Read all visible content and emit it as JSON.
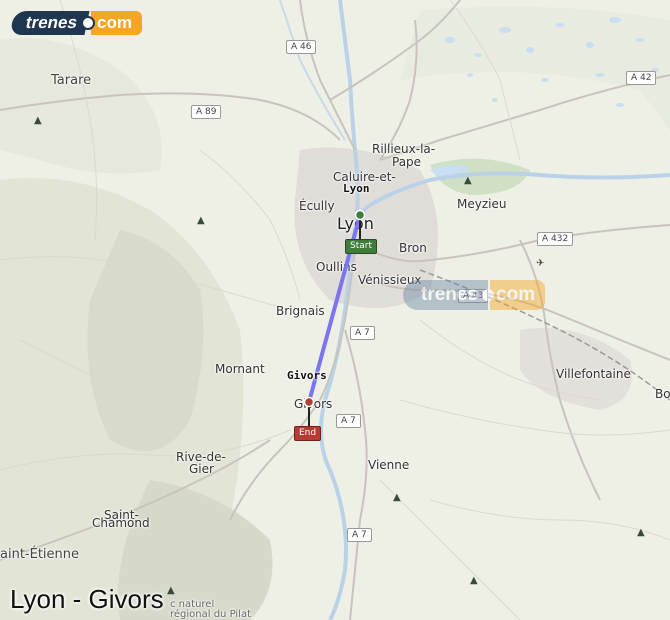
{
  "brand": {
    "part1": "trenes",
    "part2": "com"
  },
  "watermark": {
    "part1": "trenes",
    "part2": "com"
  },
  "route": {
    "title": "Lyon - Givors",
    "origin": "Lyon",
    "destination": "Givors"
  },
  "markers": {
    "start_label": "Start",
    "end_label": "End"
  },
  "places": {
    "lyon": "Lyon",
    "tarare": "Tarare",
    "rillieux": "Rillieux-la-",
    "rillieux2": "Pape",
    "caluire": "Caluire-et-",
    "ecully": "Écully",
    "meyzieu": "Meyzieu",
    "bron": "Bron",
    "oullins": "Oullins",
    "venissieux": "Vénissieux",
    "brignais": "Brignais",
    "mornant": "Mornant",
    "givors": "Givors",
    "villefontaine": "Villefontaine",
    "bo": "Bo",
    "rive": "Rive-de-",
    "gier": "Gier",
    "saint_chamond_1": "Saint-",
    "saint_chamond_2": "Chamond",
    "saint_etienne": "aint-Étienne",
    "vienne": "Vienne",
    "pilat_1": "c naturel",
    "pilat_2": "régional du Pilat"
  },
  "roads": {
    "a46": "A 46",
    "a42": "A 42",
    "a89": "A 89",
    "a432": "A 432",
    "a43": "A 43",
    "a7_1": "A 7",
    "a7_2": "A 7",
    "a7_3": "A 7"
  },
  "colors": {
    "route_line": "#7b76f0",
    "start_marker": "#3f7e3a",
    "end_marker": "#b83b33",
    "brand_dark": "#1f3650",
    "brand_orange": "#f6a623"
  }
}
